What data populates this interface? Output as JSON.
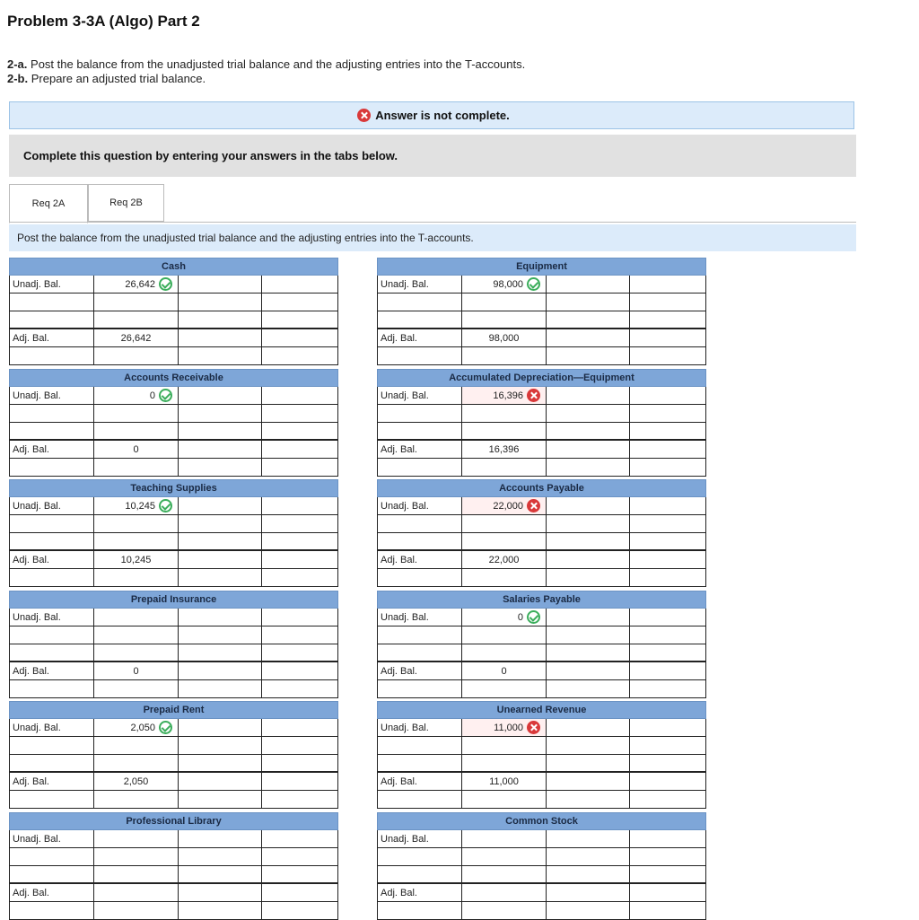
{
  "title": "Problem 3-3A (Algo) Part 2",
  "instructions": [
    {
      "label": "2-a.",
      "text": " Post the balance from the unadjusted trial balance and the adjusting entries into the T-accounts."
    },
    {
      "label": "2-b.",
      "text": " Prepare an adjusted trial balance."
    }
  ],
  "banner": {
    "text": "Answer is not complete.",
    "icon": "x-circle-icon"
  },
  "complete_prompt": "Complete this question by entering your answers in the tabs below.",
  "tabs": [
    {
      "label": "Req 2A",
      "active": true
    },
    {
      "label": "Req 2B",
      "active": false
    }
  ],
  "req_description": "Post the balance from the unadjusted trial balance and the adjusting entries into the T-accounts.",
  "row_labels": {
    "unadj": "Unadj. Bal.",
    "adj": "Adj. Bal."
  },
  "colors": {
    "header_blue": "#7ea6d8",
    "banner_blue": "#dcebfa",
    "correct_green": "#3cae5c",
    "error_red": "#d9393a"
  },
  "accounts_left": [
    {
      "name": "Cash",
      "unadj_value": "26,642",
      "unadj_status": "correct",
      "adj_value": "26,642"
    },
    {
      "name": "Accounts Receivable",
      "unadj_value": "0",
      "unadj_status": "correct",
      "adj_value": "0"
    },
    {
      "name": "Teaching Supplies",
      "unadj_value": "10,245",
      "unadj_status": "correct",
      "adj_value": "10,245"
    },
    {
      "name": "Prepaid Insurance",
      "unadj_value": "",
      "unadj_status": "",
      "adj_value": "0"
    },
    {
      "name": "Prepaid Rent",
      "unadj_value": "2,050",
      "unadj_status": "correct",
      "adj_value": "2,050"
    },
    {
      "name": "Professional Library",
      "unadj_value": "",
      "unadj_status": "",
      "adj_value": ""
    }
  ],
  "accounts_right": [
    {
      "name": "Equipment",
      "unadj_value": "98,000",
      "unadj_status": "correct",
      "adj_value": "98,000"
    },
    {
      "name": "Accumulated Depreciation—Equipment",
      "unadj_value": "16,396",
      "unadj_status": "incorrect",
      "adj_value": "16,396"
    },
    {
      "name": "Accounts Payable",
      "unadj_value": "22,000",
      "unadj_status": "incorrect",
      "adj_value": "22,000"
    },
    {
      "name": "Salaries Payable",
      "unadj_value": "0",
      "unadj_status": "correct",
      "adj_value": "0"
    },
    {
      "name": "Unearned Revenue",
      "unadj_value": "11,000",
      "unadj_status": "incorrect",
      "adj_value": "11,000"
    },
    {
      "name": "Common Stock",
      "unadj_value": "",
      "unadj_status": "",
      "adj_value": ""
    }
  ]
}
